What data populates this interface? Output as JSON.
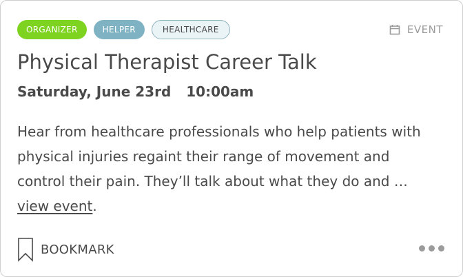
{
  "card": {
    "tags": [
      {
        "label": "ORGANIZER"
      },
      {
        "label": "HELPER"
      },
      {
        "label": "HEALTHCARE"
      }
    ],
    "event_type": {
      "label": "EVENT",
      "icon": "calendar-icon"
    },
    "title": "Physical Therapist Career Talk",
    "date": "Saturday, June 23rd",
    "time": "10:00am",
    "description": {
      "text": "Hear from healthcare professionals who help patients with physical injuries regaint their range of movement and control their pain. They’ll talk about what they do and … ",
      "link_label": "view event",
      "trailing": "."
    },
    "bookmark": {
      "label": "BOOKMARK",
      "icon": "bookmark-icon"
    },
    "more": {
      "icon": "more-dots-icon"
    },
    "colors": {
      "organizer": "#7ed321",
      "helper": "#7fb3c3",
      "healthcare_bg": "#eaf3f5",
      "text": "#4a4a4a",
      "muted": "#9b9b9b"
    }
  }
}
